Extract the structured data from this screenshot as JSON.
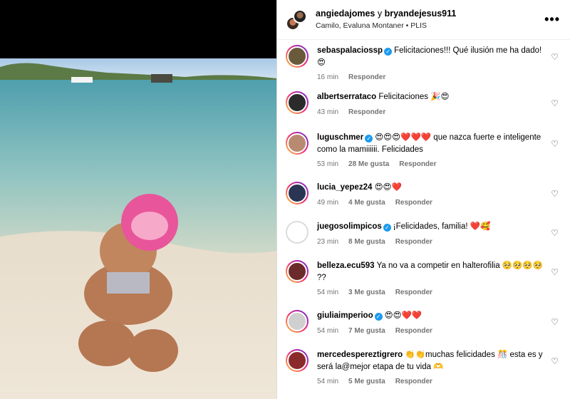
{
  "header": {
    "user1": "angiedajomes",
    "joiner": " y ",
    "user2": "bryandejesus911",
    "audio": "Camilo, Evaluna Montaner • PLIS"
  },
  "comments": [
    {
      "user": "sebaspalaciossp",
      "verified": true,
      "text": "Felicitaciones!!! Qué ilusión me ha dado! 😍",
      "time": "16 min",
      "likes": "",
      "reply": "Responder",
      "avatar_color": "#6a5a3c"
    },
    {
      "user": "albertserrataco",
      "verified": false,
      "text": "Felicitaciones 🎉😍",
      "time": "43 min",
      "likes": "",
      "reply": "Responder",
      "avatar_color": "#2b2b2b"
    },
    {
      "user": "luguschmer",
      "verified": true,
      "text": "😍😍😍❤️❤️❤️ que nazca fuerte e inteligente como la mamiiiiii. Felicidades",
      "time": "53 min",
      "likes": "28 Me gusta",
      "reply": "Responder",
      "avatar_color": "#b98a72"
    },
    {
      "user": "lucia_yepez24",
      "verified": false,
      "text": "😍😍❤️",
      "time": "49 min",
      "likes": "4 Me gusta",
      "reply": "Responder",
      "avatar_color": "#2a3553"
    },
    {
      "user": "juegosolimpicos",
      "verified": true,
      "text": "¡Felicidades, familia! ❤️🥰",
      "time": "23 min",
      "likes": "8 Me gusta",
      "reply": "Responder",
      "avatar_color": "#ffffff"
    },
    {
      "user": "belleza.ecu593",
      "verified": false,
      "text": "Ya no va a competir en halterofilia 🥺🥺🥺🥺 ??",
      "time": "54 min",
      "likes": "3 Me gusta",
      "reply": "Responder",
      "avatar_color": "#6b2b2b"
    },
    {
      "user": "giuliaimperioo",
      "verified": true,
      "text": "😍😍❤️❤️",
      "time": "54 min",
      "likes": "7 Me gusta",
      "reply": "Responder",
      "avatar_color": "#cfcfcf"
    },
    {
      "user": "mercedespereztigrero",
      "verified": false,
      "text": "👏👏muchas felicidades 🎊 esta es y será la@mejor etapa de tu vida 🫶",
      "time": "54 min",
      "likes": "5 Me gusta",
      "reply": "Responder",
      "avatar_color": "#8a2a2a"
    }
  ],
  "colors": {
    "verified": "#1d9bf0",
    "muted": "#737373"
  }
}
